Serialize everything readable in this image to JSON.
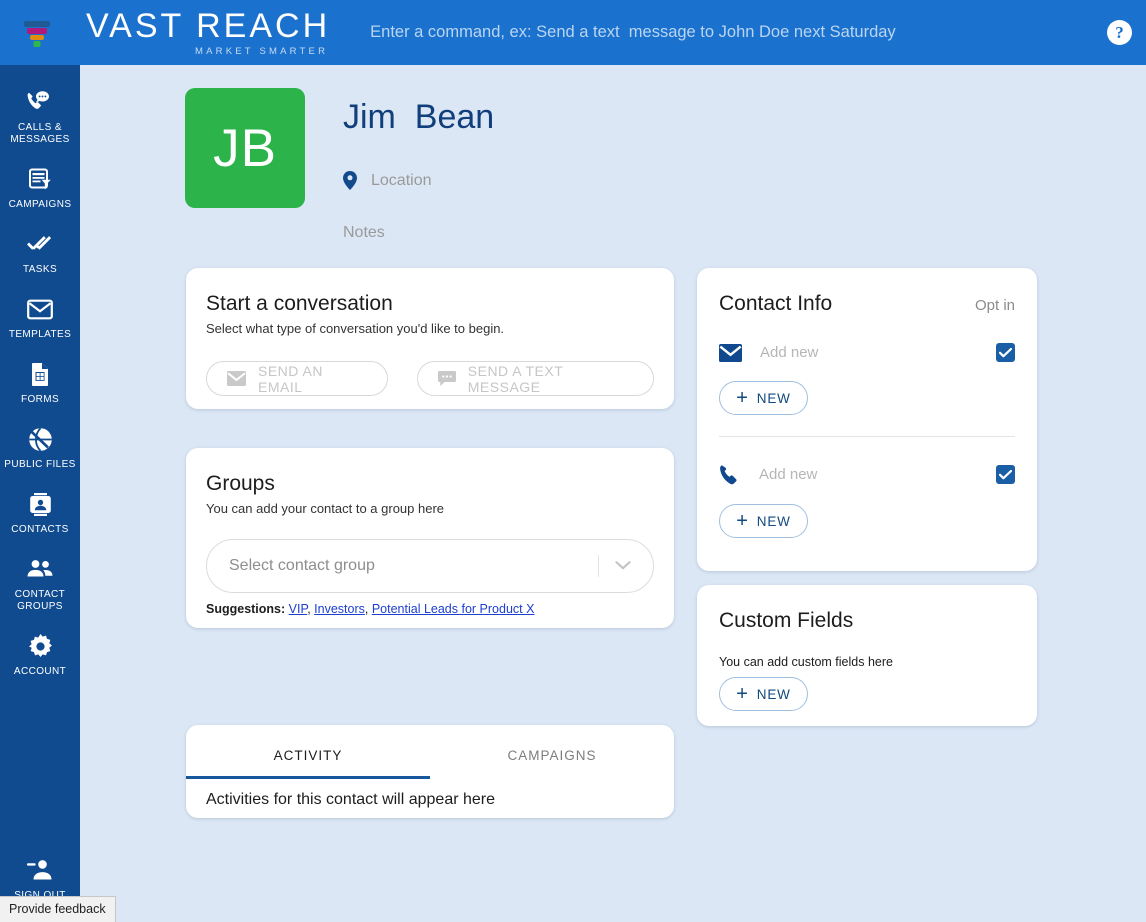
{
  "topbar": {
    "logo_icon": "funnel-logo-icon",
    "brand_name": "VAST REACH",
    "brand_tagline": "MARKET SMARTER",
    "command_hint": "Enter a command, ex: Send a text  message to John Doe next Saturday",
    "help_label": "?",
    "bg_color": "#1b71ce"
  },
  "sidebar": {
    "bg_color": "#114b8f",
    "items": [
      {
        "label": "CALLS & MESSAGES",
        "icon": "phone-chat-icon"
      },
      {
        "label": "CAMPAIGNS",
        "icon": "campaign-calendar-icon"
      },
      {
        "label": "TASKS",
        "icon": "double-check-icon"
      },
      {
        "label": "TEMPLATES",
        "icon": "envelope-icon"
      },
      {
        "label": "FORMS",
        "icon": "form-document-icon"
      },
      {
        "label": "PUBLIC FILES",
        "icon": "globe-icon"
      },
      {
        "label": "CONTACTS",
        "icon": "contact-card-icon"
      },
      {
        "label": "CONTACT GROUPS",
        "icon": "people-group-icon"
      },
      {
        "label": "ACCOUNT",
        "icon": "gear-icon"
      }
    ],
    "sign_out": {
      "label": "SIGN OUT",
      "icon": "sign-out-person-icon"
    }
  },
  "feedback_tab": {
    "label": "Provide feedback"
  },
  "profile": {
    "initials": "JB",
    "avatar_color": "#2cb34a",
    "name": "Jim  Bean",
    "location_placeholder": "Location",
    "location_icon": "map-pin-icon",
    "notes_placeholder": "Notes"
  },
  "conversation_card": {
    "title": "Start a conversation",
    "subtitle": "Select what type of conversation you'd like to begin.",
    "email_button": {
      "label": "SEND AN EMAIL",
      "icon": "envelope-icon"
    },
    "text_button": {
      "label": "SEND A TEXT MESSAGE",
      "icon": "chat-bubble-icon"
    }
  },
  "groups_card": {
    "title": "Groups",
    "subtitle": "You can add your contact to a group here",
    "select_placeholder": "Select contact group",
    "chevron_icon": "chevron-down-icon",
    "suggestions_label": "Suggestions:",
    "suggestions": [
      "VIP",
      "Investors",
      "Potential Leads for Product X"
    ]
  },
  "tabs_card": {
    "tabs": [
      {
        "label": "ACTIVITY",
        "active": true
      },
      {
        "label": "CAMPAIGNS",
        "active": false
      }
    ],
    "empty_message": "Activities for this contact will appear here",
    "active_indicator_color": "#16579e"
  },
  "contact_info_card": {
    "title": "Contact Info",
    "optin_label": "Opt in",
    "rows": [
      {
        "icon": "envelope-icon",
        "placeholder": "Add new",
        "checked": true,
        "new_label": "NEW"
      },
      {
        "icon": "phone-icon",
        "placeholder": "Add new",
        "checked": true,
        "new_label": "NEW"
      }
    ],
    "checkbox_color": "#1a5ea6"
  },
  "custom_fields_card": {
    "title": "Custom Fields",
    "subtitle": "You can add custom fields here",
    "new_label": "NEW"
  }
}
